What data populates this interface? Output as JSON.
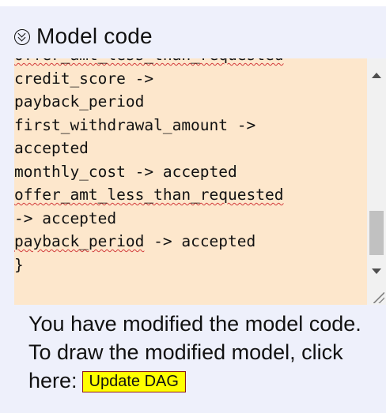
{
  "header": {
    "title": "Model code",
    "toggle_icon": "double-chevron-down-circle-icon"
  },
  "code_box": {
    "lines": [
      {
        "text": "offer_amt_less_than_requested",
        "squiggle": true
      },
      {
        "text": "credit_score ->",
        "squiggle": false
      },
      {
        "text": "payback_period",
        "squiggle": false
      },
      {
        "text": "first_withdrawal_amount ->",
        "squiggle": false
      },
      {
        "text": "accepted",
        "squiggle": false
      },
      {
        "text": "monthly_cost -> accepted",
        "squiggle": false
      },
      {
        "text": "offer_amt_less_than_requested",
        "squiggle": true
      },
      {
        "text": "-> accepted",
        "squiggle": false
      },
      {
        "text": "payback_period",
        "squiggle": true,
        "suffix": " -> accepted"
      },
      {
        "text": "}",
        "squiggle": false
      }
    ],
    "scrollbar": {
      "up_icon": "scroll-up-arrow-icon",
      "down_icon": "scroll-down-arrow-icon"
    }
  },
  "message": {
    "text": "You have modified the model code. To draw the modified model, click here:",
    "button_label": "Update DAG"
  },
  "colors": {
    "panel_bg": "#eef0fb",
    "code_bg": "#fde7cc",
    "button_bg": "#ffff00",
    "button_border": "#8b1a1a",
    "spellcheck": "#d23b3b"
  }
}
